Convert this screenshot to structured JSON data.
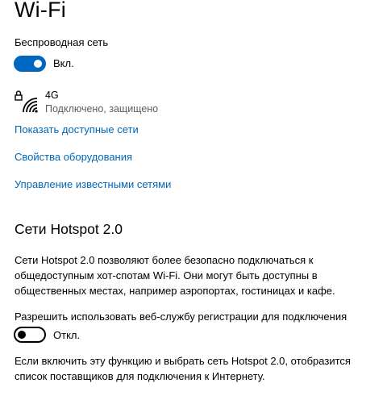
{
  "page": {
    "title": "Wi-Fi"
  },
  "wireless": {
    "section_label": "Беспроводная сеть",
    "toggle_state_label": "Вкл.",
    "toggle_on": true
  },
  "network": {
    "name": "4G",
    "status": "Подключено, защищено",
    "icon": "wifi-secured-icon"
  },
  "links": {
    "show_available": "Показать доступные сети",
    "hardware_properties": "Свойства оборудования",
    "manage_known": "Управление известными сетями"
  },
  "hotspot": {
    "heading": "Сети Hotspot 2.0",
    "description": "Сети Hotspot 2.0 позволяют более безопасно подключаться к общедоступным хот-спотам Wi-Fi. Они могут быть доступны в общественных местах, например аэропортах, гостиницах и кафе.",
    "registration_label": "Разрешить использовать веб-службу регистрации для подключения",
    "toggle_state_label": "Откл.",
    "toggle_on": false,
    "footer_text": "Если включить эту функцию и выбрать сеть Hotspot 2.0, отобразится список поставщиков для подключения к Интернету."
  },
  "colors": {
    "accent": "#0067c0",
    "link": "#0067b8",
    "muted_text": "#5d5d5d"
  }
}
